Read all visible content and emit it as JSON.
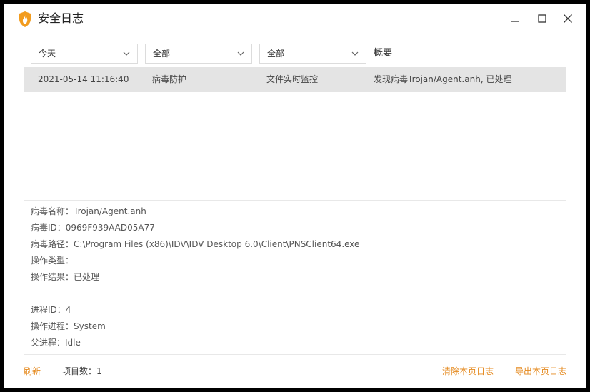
{
  "window": {
    "title": "安全日志"
  },
  "filters": {
    "time": "今天",
    "type": "全部",
    "module": "全部",
    "summary_header": "概要"
  },
  "log_rows": [
    {
      "time": "2021-05-14 11:16:40",
      "type": "病毒防护",
      "module": "文件实时监控",
      "summary": "发现病毒Trojan/Agent.anh, 已处理"
    }
  ],
  "details": [
    {
      "label": "病毒名称：",
      "value": "Trojan/Agent.anh"
    },
    {
      "label": "病毒ID：",
      "value": "0969F939AAD05A77"
    },
    {
      "label": "病毒路径：",
      "value": "C:\\Program Files (x86)\\IDV\\IDV Desktop 6.0\\Client\\PNSClient64.exe"
    },
    {
      "label": "操作类型：",
      "value": ""
    },
    {
      "label": "操作结果：",
      "value": "已处理"
    },
    {
      "label": "进程ID：",
      "value": "4"
    },
    {
      "label": "操作进程：",
      "value": "System"
    },
    {
      "label": "父进程：",
      "value": "Idle"
    }
  ],
  "footer": {
    "refresh": "刷新",
    "item_count_label": "项目数：",
    "item_count": "1",
    "clear_page_log": "清除本页日志",
    "export_page_log": "导出本页日志"
  },
  "colors": {
    "accent": "#e58a1f",
    "selected_row": "#e4e4e4",
    "logo": "#f29c1f"
  },
  "icons": {
    "logo": "shield-flame-icon",
    "minimize": "minimize-icon",
    "maximize": "maximize-icon",
    "close": "close-icon",
    "dropdown": "chevron-down-icon"
  }
}
